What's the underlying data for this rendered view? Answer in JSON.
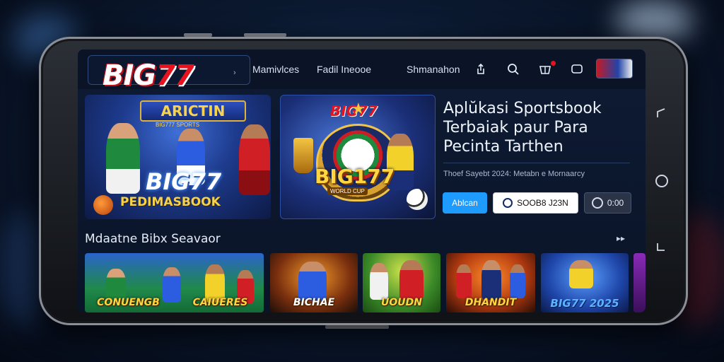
{
  "nav": {
    "logo": {
      "main": "BIG",
      "accent": "77"
    },
    "links": [
      "Mamivlces",
      "Fadil Ineooe",
      "Shmanahon"
    ],
    "icons": [
      "share-icon",
      "search-icon",
      "gift-icon",
      "chat-icon"
    ]
  },
  "banner1": {
    "title": "ARICTIN",
    "subtitle": "BIG777 SPORTS",
    "brand": "BIG77",
    "footer": "PEDIMASBOOK"
  },
  "banner2": {
    "brand": "BIG77",
    "emblem": "BIG177",
    "ribbon": "WORLD CUP"
  },
  "hero": {
    "title_lines": [
      "Aplŭkasi Sportsbook",
      "Terbaiak paur Para",
      "Pecinta Tarthen"
    ],
    "desc": "Thoef Sayebt 2024: Metabn e Mornaarcy",
    "buttons": {
      "primary": "Ablcan",
      "secondary": "SOOB8 J23N",
      "tertiary": "0:00"
    }
  },
  "section": {
    "title": "Mdaatne Bibx Seavaor",
    "arrow": "▸▸",
    "cards": [
      {
        "label": "CONUENGB"
      },
      {
        "label": "BICHAE"
      },
      {
        "label": "UOUDN"
      },
      {
        "label": "DHANDIT"
      },
      {
        "label": "BIG77 2025"
      },
      {
        "label": ""
      }
    ],
    "card_extra": [
      "CAIUERES"
    ]
  },
  "colors": {
    "brand_red": "#e8121e",
    "accent_blue": "#1e9bff",
    "gold": "#ffd540"
  }
}
